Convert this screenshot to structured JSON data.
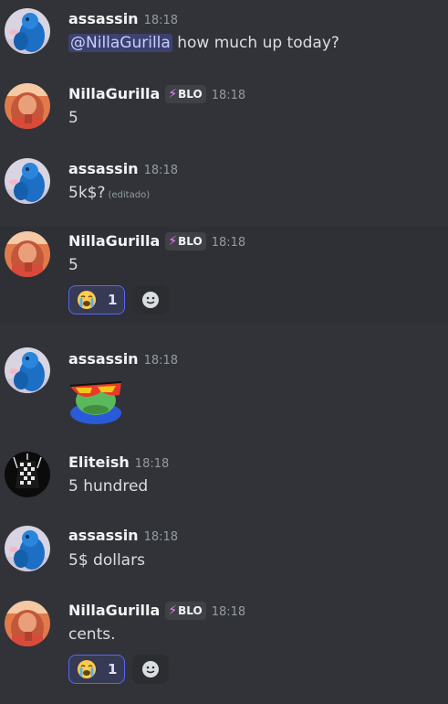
{
  "colors": {
    "background": "#313338",
    "hover_background": "#2e3035",
    "mention_bg": "#3c4270",
    "badge_bolt": "#f47fff",
    "reaction_border": "#5865f2"
  },
  "messages": [
    {
      "author": "assassin",
      "time": "18:18",
      "mention": "@NillaGurilla",
      "text": " how much up today?"
    },
    {
      "author": "NillaGurilla",
      "badge": "BLO",
      "time": "18:18",
      "text": "5"
    },
    {
      "author": "assassin",
      "time": "18:18",
      "text": "5k$?",
      "edited_label": "(editado)"
    },
    {
      "author": "NillaGurilla",
      "badge": "BLO",
      "time": "18:18",
      "text": "5",
      "reaction": {
        "emoji": "crying-face",
        "count": "1"
      }
    },
    {
      "author": "assassin",
      "time": "18:18",
      "sticker": "pepe-sunglasses-emote"
    },
    {
      "author": "Eliteish",
      "time": "18:18",
      "text": "5 hundred"
    },
    {
      "author": "assassin",
      "time": "18:18",
      "text": "5$ dollars"
    },
    {
      "author": "NillaGurilla",
      "badge": "BLO",
      "time": "18:18",
      "text": "cents.",
      "reaction": {
        "emoji": "crying-face",
        "count": "1"
      }
    }
  ]
}
